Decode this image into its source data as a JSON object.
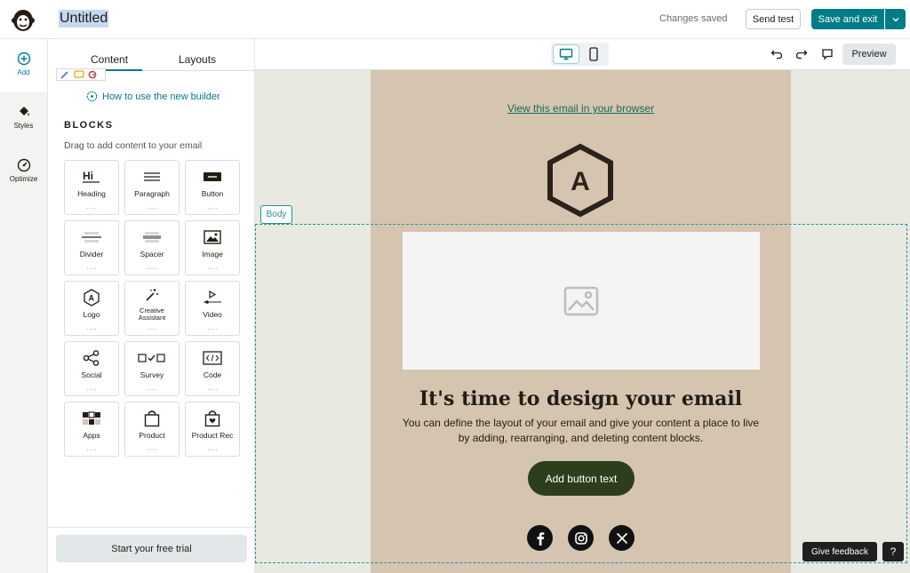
{
  "header": {
    "logo_icon": "mailchimp-logo-icon",
    "title": "Untitled",
    "status": "Changes saved",
    "send_test_label": "Send test",
    "save_exit_label": "Save and exit",
    "accent_color": "#007c89"
  },
  "rail": {
    "items": [
      {
        "label": "Add",
        "icon": "plus-circle-icon"
      },
      {
        "label": "Styles",
        "icon": "paint-bucket-icon"
      },
      {
        "label": "Optimize",
        "icon": "gauge-icon"
      }
    ]
  },
  "sidebar": {
    "tabs": [
      {
        "label": "Content",
        "active": true
      },
      {
        "label": "Layouts",
        "active": false
      }
    ],
    "help_link": "How to use the new builder",
    "blocks_heading": "BLOCKS",
    "blocks_subtitle": "Drag to add content to your email",
    "blocks": [
      {
        "label": "Heading",
        "icon": "heading-icon"
      },
      {
        "label": "Paragraph",
        "icon": "paragraph-icon"
      },
      {
        "label": "Button",
        "icon": "button-icon"
      },
      {
        "label": "Divider",
        "icon": "divider-icon"
      },
      {
        "label": "Spacer",
        "icon": "spacer-icon"
      },
      {
        "label": "Image",
        "icon": "image-icon"
      },
      {
        "label": "Logo",
        "icon": "logo-icon"
      },
      {
        "label": "Creative Assistant",
        "icon": "magic-wand-icon"
      },
      {
        "label": "Video",
        "icon": "video-icon"
      },
      {
        "label": "Social",
        "icon": "share-icon"
      },
      {
        "label": "Survey",
        "icon": "survey-icon"
      },
      {
        "label": "Code",
        "icon": "code-icon"
      },
      {
        "label": "Apps",
        "icon": "apps-icon"
      },
      {
        "label": "Product",
        "icon": "shopping-bag-icon"
      },
      {
        "label": "Product Rec",
        "icon": "product-rec-icon"
      }
    ],
    "trial_button": "Start your free trial"
  },
  "canvas_toolbar": {
    "device_desktop": "desktop-icon",
    "device_mobile": "mobile-icon",
    "undo": "undo-icon",
    "redo": "redo-icon",
    "comment": "comment-icon",
    "preview_label": "Preview"
  },
  "email": {
    "view_in_browser": "View this email in your browser",
    "logo_letter": "A",
    "heading": "It's time to design your email",
    "body": "You can define the layout of your email and give your content a place to live by adding, rearranging, and deleting content blocks.",
    "button_label": "Add button text",
    "background_color": "#d5c5b0",
    "button_color": "#2d3e1f",
    "social_icons": [
      "facebook-icon",
      "instagram-icon",
      "x-icon"
    ]
  },
  "selection": {
    "tag_label": "Body"
  },
  "floating": {
    "feedback_label": "Give feedback",
    "help_label": "?"
  }
}
